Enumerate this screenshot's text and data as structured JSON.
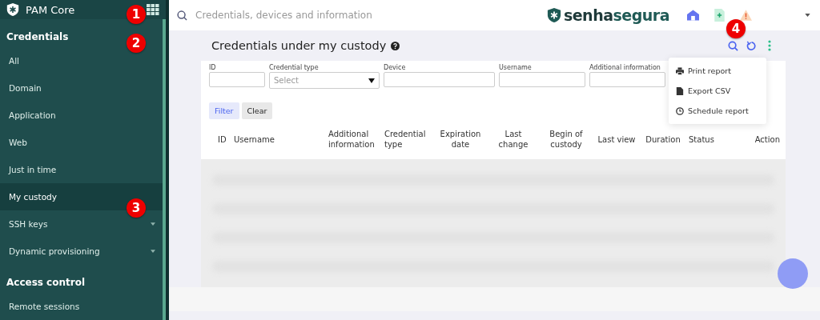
{
  "app": {
    "name": "PAM Core"
  },
  "search": {
    "placeholder": "Credentials, devices and information"
  },
  "brand": {
    "prefix": "senha",
    "suffix": "segura"
  },
  "sidebar": {
    "sections": [
      {
        "title": "Credentials",
        "items": [
          {
            "label": "All",
            "selected": false,
            "has_submenu": false
          },
          {
            "label": "Domain",
            "selected": false,
            "has_submenu": false
          },
          {
            "label": "Application",
            "selected": false,
            "has_submenu": false
          },
          {
            "label": "Web",
            "selected": false,
            "has_submenu": false
          },
          {
            "label": "Just in time",
            "selected": false,
            "has_submenu": false
          },
          {
            "label": "My custody",
            "selected": true,
            "has_submenu": false
          },
          {
            "label": "SSH keys",
            "selected": false,
            "has_submenu": true
          },
          {
            "label": "Dynamic provisioning",
            "selected": false,
            "has_submenu": true
          }
        ]
      },
      {
        "title": "Access control",
        "items": [
          {
            "label": "Remote sessions",
            "selected": false,
            "has_submenu": false
          }
        ]
      }
    ]
  },
  "page": {
    "title": "Credentials under my custody"
  },
  "filters": [
    {
      "label": "ID",
      "kind": "text"
    },
    {
      "label": "Credential type",
      "kind": "select",
      "placeholder": "Select"
    },
    {
      "label": "Device",
      "kind": "text"
    },
    {
      "label": "Username",
      "kind": "text"
    },
    {
      "label": "Additional information",
      "kind": "text"
    }
  ],
  "filter_buttons": [
    {
      "label": "Filter",
      "kind": "primary"
    },
    {
      "label": "Clear",
      "kind": "secondary"
    }
  ],
  "menu": [
    {
      "label": "Print report"
    },
    {
      "label": "Export CSV"
    },
    {
      "label": "Schedule report"
    }
  ],
  "table": {
    "columns": [
      {
        "label": "ID"
      },
      {
        "label": "Username"
      },
      {
        "label": "Additional information"
      },
      {
        "label": "Credential type"
      },
      {
        "label": "Expiration date"
      },
      {
        "label": "Last change"
      },
      {
        "label": "Begin of custody"
      },
      {
        "label": "Last view"
      },
      {
        "label": "Duration"
      },
      {
        "label": "Status"
      },
      {
        "label": "Action"
      }
    ]
  },
  "callouts": [
    "1",
    "2",
    "3",
    "4"
  ]
}
